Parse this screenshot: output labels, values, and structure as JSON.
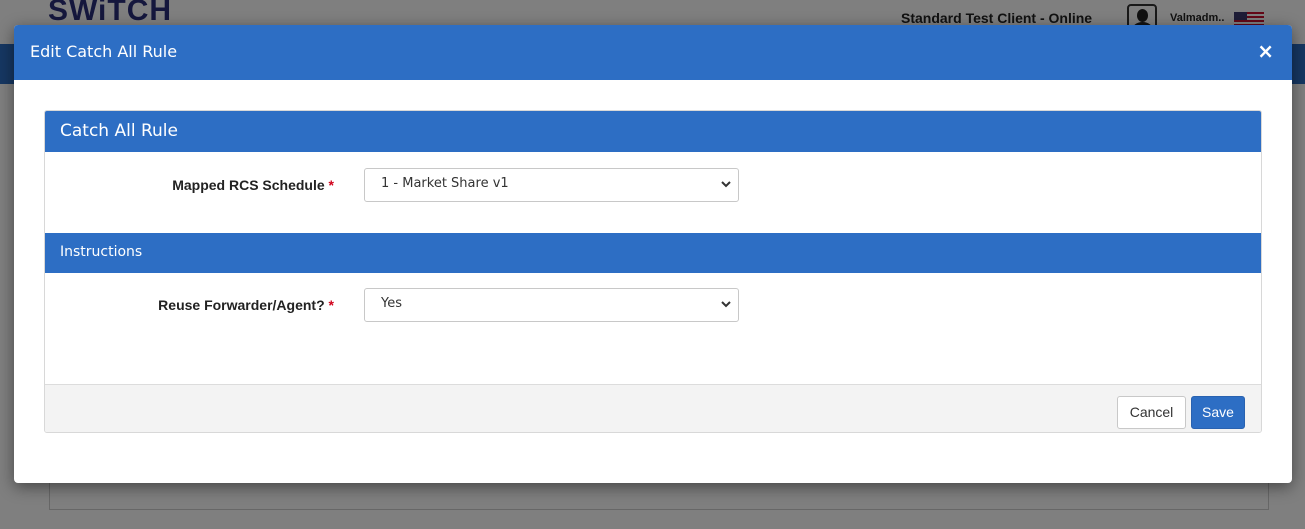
{
  "background": {
    "logo_text": "SWiTCH",
    "client_status": "Standard Test Client - Online",
    "user_name": "Valmadm..",
    "avatar_icon": "user-avatar-icon",
    "flag_icon": "us-flag-icon"
  },
  "modal": {
    "title": "Edit Catch All Rule",
    "close_symbol": "×",
    "panel_title": "Catch All Rule",
    "fields": [
      {
        "label": "Mapped RCS Schedule",
        "required_mark": "*",
        "value": "1 - Market Share v1"
      },
      {
        "label": "Reuse Forwarder/Agent?",
        "required_mark": "*",
        "value": "Yes"
      }
    ],
    "instructions_heading": "Instructions",
    "cancel_label": "Cancel",
    "save_label": "Save"
  },
  "colors": {
    "primary": "#2d6ec4",
    "required": "#d0021b",
    "footer_bg": "#f3f3f3"
  }
}
